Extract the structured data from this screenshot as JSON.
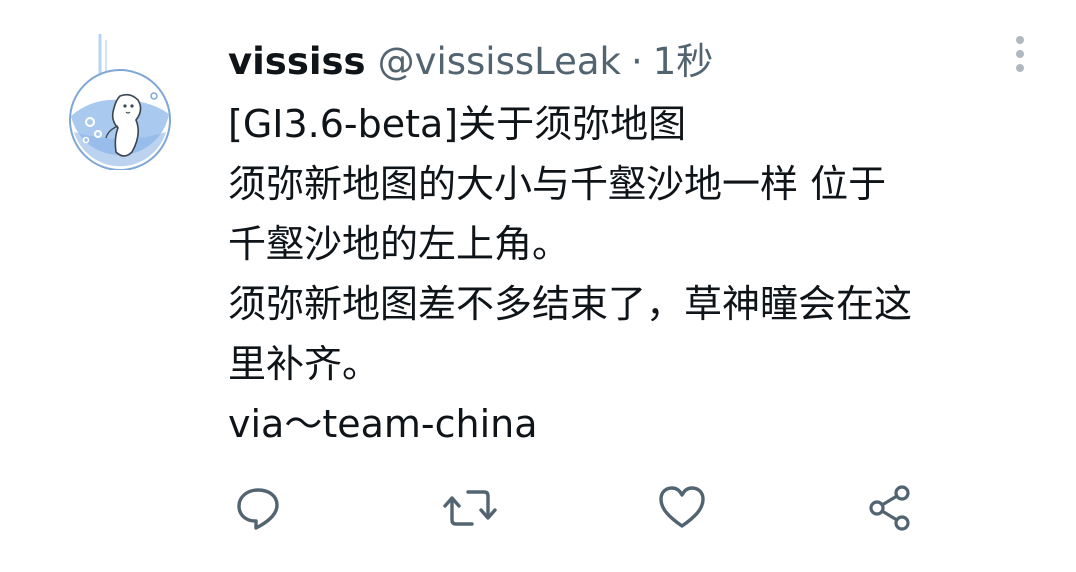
{
  "tweet": {
    "display_name": "vississ",
    "handle": "@vississLeak",
    "separator": "·",
    "time": "1秒",
    "lines": [
      "[GI3.6-beta]关于须弥地图",
      "须弥新地图的大小与千壑沙地一样 位于",
      "千壑沙地的左上角。",
      "须弥新地图差不多结束了，草神瞳会在这",
      "里补齐。",
      "via～team-china"
    ]
  },
  "icons": {
    "more": "more-vertical-icon",
    "reply": "reply-icon",
    "retweet": "retweet-icon",
    "like": "heart-icon",
    "share": "share-icon"
  },
  "colors": {
    "text_primary": "#0f1419",
    "text_secondary": "#536471",
    "icon": "#536471",
    "avatar_water": "#a9c9ef"
  }
}
